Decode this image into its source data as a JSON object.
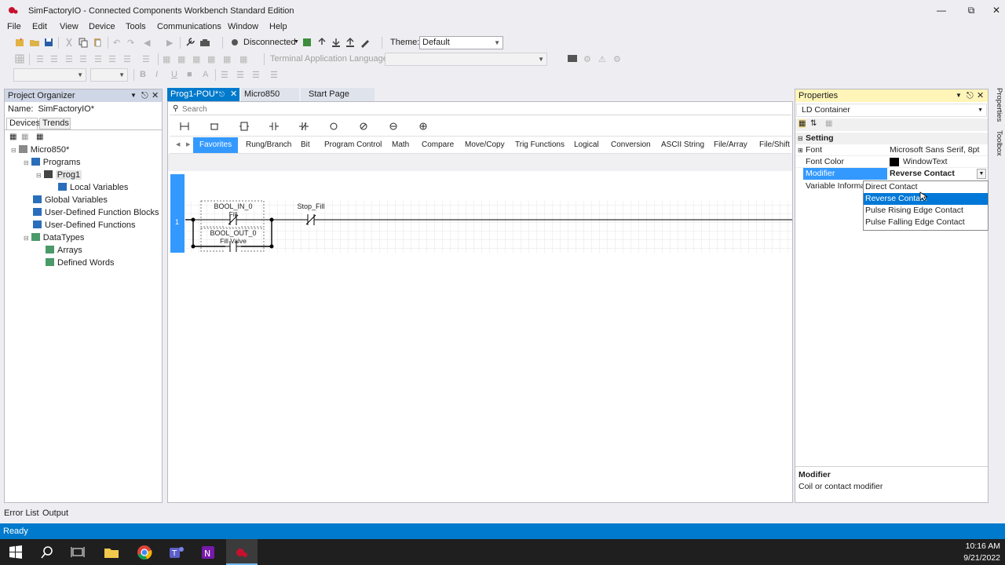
{
  "window": {
    "title": "SimFactoryIO - Connected Components Workbench Standard Edition"
  },
  "menu": [
    "File",
    "Edit",
    "View",
    "Device",
    "Tools",
    "Communications",
    "Window",
    "Help"
  ],
  "toolbar": {
    "connection": "Disconnected",
    "theme_label": "Theme:",
    "theme_value": "Default",
    "terminal_label": "Terminal Application Language:"
  },
  "project_organizer": {
    "title": "Project Organizer",
    "name_label": "Name:",
    "name_value": "SimFactoryIO*",
    "tabs": [
      "Devices",
      "Trends"
    ],
    "tree": [
      {
        "label": "Micro850*",
        "level": 0
      },
      {
        "label": "Programs",
        "level": 1
      },
      {
        "label": "Prog1",
        "level": 2
      },
      {
        "label": "Local Variables",
        "level": 3
      },
      {
        "label": "Global Variables",
        "level": 1
      },
      {
        "label": "User-Defined Function Blocks",
        "level": 1
      },
      {
        "label": "User-Defined Functions",
        "level": 1
      },
      {
        "label": "DataTypes",
        "level": 1
      },
      {
        "label": "Arrays",
        "level": 2
      },
      {
        "label": "Defined Words",
        "level": 2
      }
    ]
  },
  "editor": {
    "doc_tabs": [
      "Prog1-POU*",
      "Micro850",
      "Start Page"
    ],
    "search_placeholder": "Search",
    "categories": [
      "Favorites",
      "Rung/Branch",
      "Bit",
      "Program Control",
      "Math",
      "Compare",
      "Move/Copy",
      "Trig Functions",
      "Logical",
      "Conversion",
      "ASCII String",
      "File/Array",
      "File/Shift"
    ],
    "rung_number": "1",
    "contacts": [
      {
        "var": "BOOL_IN_0",
        "desc": "Fill"
      },
      {
        "var": "BOOL_OUT_0",
        "desc": "Fill Valve"
      },
      {
        "var": "Stop_Fill",
        "desc": ""
      }
    ]
  },
  "properties": {
    "title": "Properties",
    "object": "LD Container",
    "category": "Setting",
    "rows": [
      {
        "name": "Font",
        "value": "Microsoft Sans Serif, 8pt"
      },
      {
        "name": "Font Color",
        "value": "WindowText"
      },
      {
        "name": "Modifier",
        "value": "Reverse Contact"
      },
      {
        "name": "Variable Informa",
        "value": ""
      }
    ],
    "dropdown": [
      "Direct Contact",
      "Reverse Contact",
      "Pulse Rising Edge Contact",
      "Pulse Falling Edge Contact"
    ],
    "dropdown_selected": 1,
    "desc_title": "Modifier",
    "desc_text": "Coil or contact modifier"
  },
  "side_tabs": [
    "Properties",
    "Toolbox"
  ],
  "bottom_tabs": [
    "Error List",
    "Output"
  ],
  "status": "Ready",
  "clock": {
    "time": "10:16 AM",
    "date": "9/21/2022"
  },
  "colors": {
    "accent": "#007acc",
    "selection": "#3399ff",
    "props_header": "#fff5b8",
    "org_header": "#cfd6e5",
    "rung_bar": "#3399ff"
  }
}
